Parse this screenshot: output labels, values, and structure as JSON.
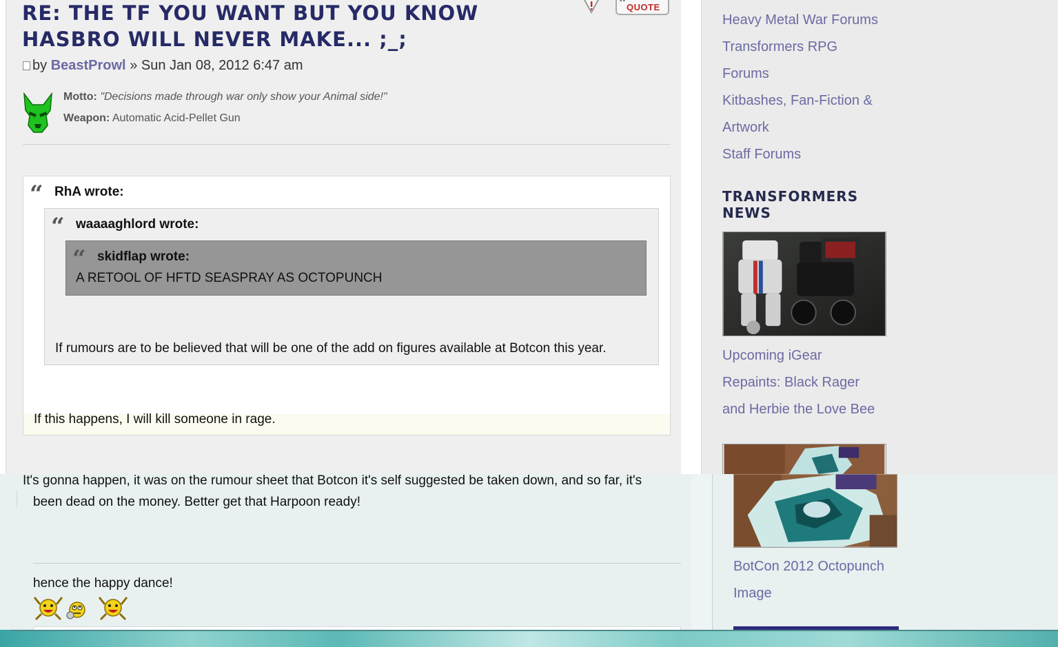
{
  "post": {
    "title": "RE: THE TF YOU WANT BUT YOU KNOW HASBRO WILL NEVER MAKE... ;_;",
    "quote_button_label": "QUOTE",
    "byline_by": "by",
    "author": "BeastProwl",
    "byline_sep": "»",
    "date": "Sun Jan 08, 2012 6:47 am",
    "profile": {
      "motto_label": "Motto:",
      "motto_value": "\"Decisions made through war only show your Animal side!\"",
      "weapon_label": "Weapon:",
      "weapon_value": "Automatic Acid-Pellet Gun"
    },
    "quote": {
      "author": "RhA wrote:",
      "text": "If this happens, I will kill someone in rage.",
      "inner": {
        "author": "waaaaghlord wrote:",
        "text": "If rumours are to be believed that will be one of the add on figures available at Botcon this year.",
        "inner": {
          "author": "skidflap wrote:",
          "text": "A RETOOL OF HFTD SEASPRAY AS OCTOPUNCH"
        }
      }
    },
    "reply_line1": "It's gonna happen, it was on the rumour sheet that Botcon it's self suggested be taken down, and so far, it's",
    "reply_line2": "been dead on the money. Better get that Harpoon ready!",
    "signature": "hence the happy dance!",
    "smilies": [
      "dancing-smiley-icon",
      "eye-roll-smiley-icon",
      "dancing-smiley-icon"
    ]
  },
  "sidebar": {
    "links": [
      "Heavy Metal War Forums",
      "Transformers RPG",
      "Forums",
      "Kitbashes, Fan-Fiction &",
      "Artwork",
      "Staff Forums"
    ],
    "news_heading_line1": "TRANSFORMERS",
    "news_heading_line2": "NEWS",
    "news_items": [
      {
        "title_lines": [
          "Upcoming iGear",
          "Repaints: Black Rager",
          "and Herbie the Love Bee"
        ]
      },
      {
        "title_lines": [
          "BotCon 2012 Octopunch",
          "Image"
        ]
      }
    ]
  },
  "colors": {
    "title": "#262a66",
    "link": "#6b6aa3",
    "lower_background": "#e9f0f0"
  }
}
